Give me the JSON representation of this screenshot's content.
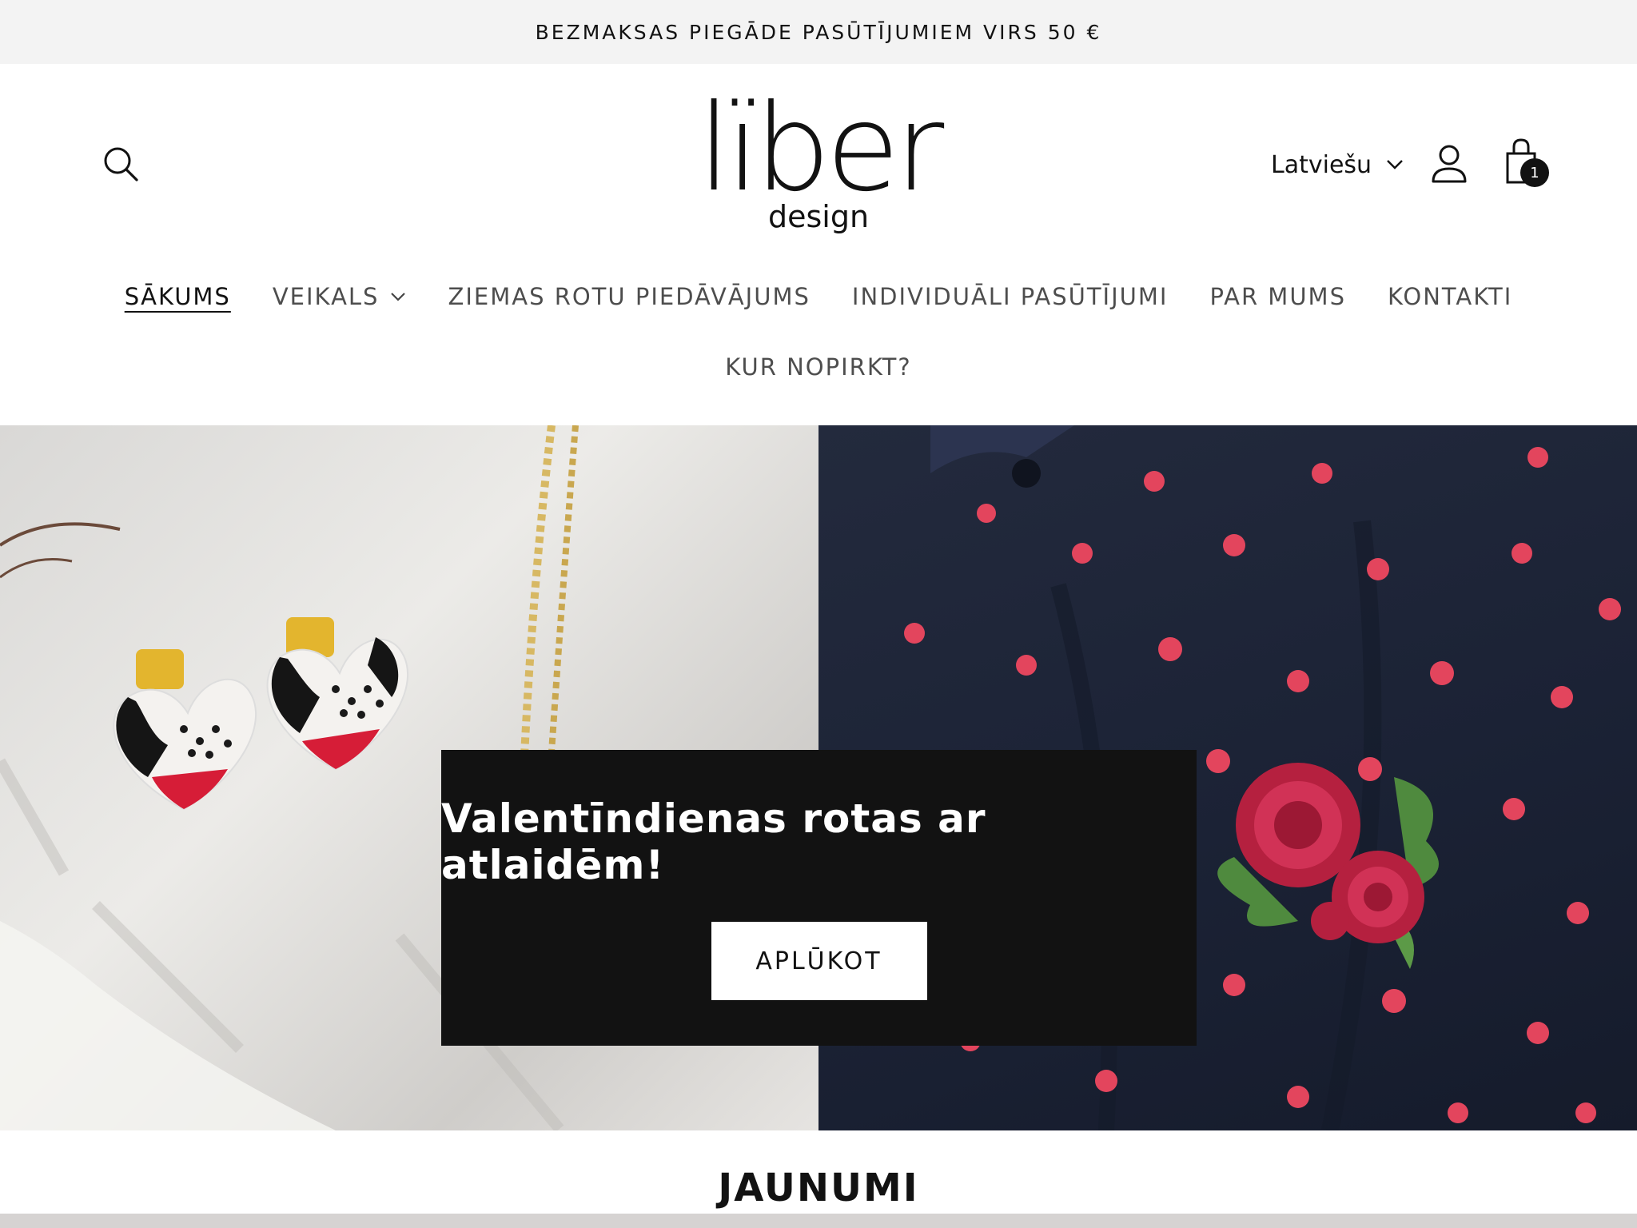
{
  "announcement": {
    "text": "BEZMAKSAS PIEGĀDE PASŪTĪJUMIEM VIRS 50 €"
  },
  "header": {
    "logo": {
      "word": "lïber",
      "sub": "design"
    },
    "language": "Latviešu",
    "cart_count": "1",
    "icons": [
      "search-icon",
      "user-icon",
      "shopping-bag-icon",
      "chevron-down-icon"
    ]
  },
  "nav": {
    "items": [
      {
        "label": "SĀKUMS",
        "active": true
      },
      {
        "label": "VEIKALS",
        "has_dropdown": true
      },
      {
        "label": "ZIEMAS ROTU PIEDĀVĀJUMS"
      },
      {
        "label": "INDIVIDUĀLI PASŪTĪJUMI"
      },
      {
        "label": "PAR MUMS"
      },
      {
        "label": "KONTAKTI"
      },
      {
        "label": "KUR NOPIRKT?"
      }
    ]
  },
  "hero": {
    "heading": "Valentīndienas rotas ar atlaidēm!",
    "button": "APLŪKOT"
  },
  "section": {
    "title": "JAUNUMI"
  },
  "colors": {
    "text": "#121212",
    "announcement_bg": "#f3f3f3",
    "hero_box": "#121212",
    "dot_red": "#e0344a",
    "rose": "#b5203f",
    "leaf": "#4f8a3e"
  }
}
